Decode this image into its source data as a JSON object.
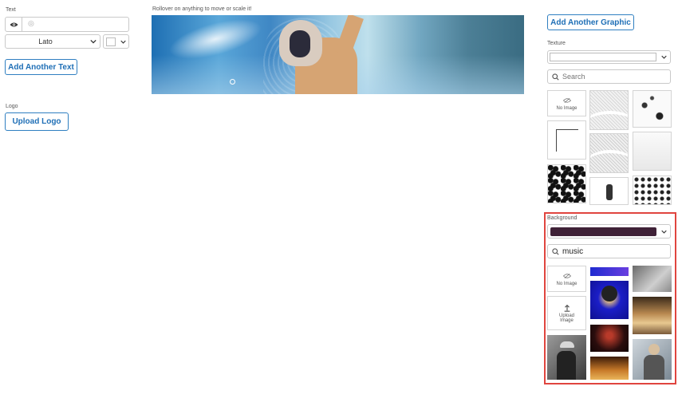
{
  "text_panel": {
    "label": "Text",
    "text_value": "",
    "font_select": "Lato",
    "add_text_label": "Add Another Text"
  },
  "logo_panel": {
    "label": "Logo",
    "upload_label": "Upload Logo"
  },
  "canvas": {
    "hint": "Rollover on anything to move or scale it!"
  },
  "right_panel": {
    "add_graphic_label": "Add Another Graphic",
    "texture": {
      "label": "Texture",
      "search_placeholder": "Search",
      "no_image_label": "No Image"
    },
    "background": {
      "label": "Background",
      "color": "#3f2137",
      "search_value": "music",
      "no_image_label": "No Image",
      "upload_label": "Upload Image"
    }
  },
  "colors": {
    "accent": "#2f7fc1",
    "highlight_border": "#e0453f"
  }
}
